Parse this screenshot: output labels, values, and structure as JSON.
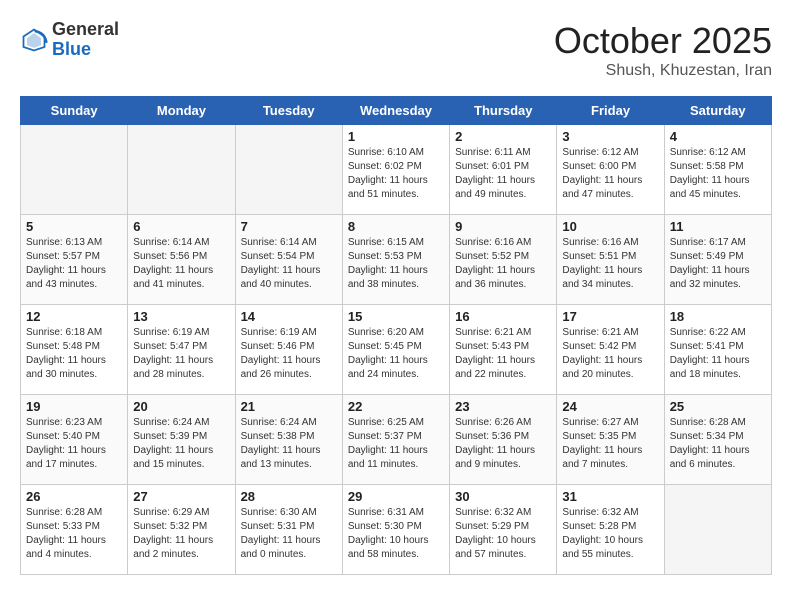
{
  "header": {
    "logo_general": "General",
    "logo_blue": "Blue",
    "month_title": "October 2025",
    "location": "Shush, Khuzestan, Iran"
  },
  "days_of_week": [
    "Sunday",
    "Monday",
    "Tuesday",
    "Wednesday",
    "Thursday",
    "Friday",
    "Saturday"
  ],
  "weeks": [
    [
      {
        "day": "",
        "info": ""
      },
      {
        "day": "",
        "info": ""
      },
      {
        "day": "",
        "info": ""
      },
      {
        "day": "1",
        "info": "Sunrise: 6:10 AM\nSunset: 6:02 PM\nDaylight: 11 hours\nand 51 minutes."
      },
      {
        "day": "2",
        "info": "Sunrise: 6:11 AM\nSunset: 6:01 PM\nDaylight: 11 hours\nand 49 minutes."
      },
      {
        "day": "3",
        "info": "Sunrise: 6:12 AM\nSunset: 6:00 PM\nDaylight: 11 hours\nand 47 minutes."
      },
      {
        "day": "4",
        "info": "Sunrise: 6:12 AM\nSunset: 5:58 PM\nDaylight: 11 hours\nand 45 minutes."
      }
    ],
    [
      {
        "day": "5",
        "info": "Sunrise: 6:13 AM\nSunset: 5:57 PM\nDaylight: 11 hours\nand 43 minutes."
      },
      {
        "day": "6",
        "info": "Sunrise: 6:14 AM\nSunset: 5:56 PM\nDaylight: 11 hours\nand 41 minutes."
      },
      {
        "day": "7",
        "info": "Sunrise: 6:14 AM\nSunset: 5:54 PM\nDaylight: 11 hours\nand 40 minutes."
      },
      {
        "day": "8",
        "info": "Sunrise: 6:15 AM\nSunset: 5:53 PM\nDaylight: 11 hours\nand 38 minutes."
      },
      {
        "day": "9",
        "info": "Sunrise: 6:16 AM\nSunset: 5:52 PM\nDaylight: 11 hours\nand 36 minutes."
      },
      {
        "day": "10",
        "info": "Sunrise: 6:16 AM\nSunset: 5:51 PM\nDaylight: 11 hours\nand 34 minutes."
      },
      {
        "day": "11",
        "info": "Sunrise: 6:17 AM\nSunset: 5:49 PM\nDaylight: 11 hours\nand 32 minutes."
      }
    ],
    [
      {
        "day": "12",
        "info": "Sunrise: 6:18 AM\nSunset: 5:48 PM\nDaylight: 11 hours\nand 30 minutes."
      },
      {
        "day": "13",
        "info": "Sunrise: 6:19 AM\nSunset: 5:47 PM\nDaylight: 11 hours\nand 28 minutes."
      },
      {
        "day": "14",
        "info": "Sunrise: 6:19 AM\nSunset: 5:46 PM\nDaylight: 11 hours\nand 26 minutes."
      },
      {
        "day": "15",
        "info": "Sunrise: 6:20 AM\nSunset: 5:45 PM\nDaylight: 11 hours\nand 24 minutes."
      },
      {
        "day": "16",
        "info": "Sunrise: 6:21 AM\nSunset: 5:43 PM\nDaylight: 11 hours\nand 22 minutes."
      },
      {
        "day": "17",
        "info": "Sunrise: 6:21 AM\nSunset: 5:42 PM\nDaylight: 11 hours\nand 20 minutes."
      },
      {
        "day": "18",
        "info": "Sunrise: 6:22 AM\nSunset: 5:41 PM\nDaylight: 11 hours\nand 18 minutes."
      }
    ],
    [
      {
        "day": "19",
        "info": "Sunrise: 6:23 AM\nSunset: 5:40 PM\nDaylight: 11 hours\nand 17 minutes."
      },
      {
        "day": "20",
        "info": "Sunrise: 6:24 AM\nSunset: 5:39 PM\nDaylight: 11 hours\nand 15 minutes."
      },
      {
        "day": "21",
        "info": "Sunrise: 6:24 AM\nSunset: 5:38 PM\nDaylight: 11 hours\nand 13 minutes."
      },
      {
        "day": "22",
        "info": "Sunrise: 6:25 AM\nSunset: 5:37 PM\nDaylight: 11 hours\nand 11 minutes."
      },
      {
        "day": "23",
        "info": "Sunrise: 6:26 AM\nSunset: 5:36 PM\nDaylight: 11 hours\nand 9 minutes."
      },
      {
        "day": "24",
        "info": "Sunrise: 6:27 AM\nSunset: 5:35 PM\nDaylight: 11 hours\nand 7 minutes."
      },
      {
        "day": "25",
        "info": "Sunrise: 6:28 AM\nSunset: 5:34 PM\nDaylight: 11 hours\nand 6 minutes."
      }
    ],
    [
      {
        "day": "26",
        "info": "Sunrise: 6:28 AM\nSunset: 5:33 PM\nDaylight: 11 hours\nand 4 minutes."
      },
      {
        "day": "27",
        "info": "Sunrise: 6:29 AM\nSunset: 5:32 PM\nDaylight: 11 hours\nand 2 minutes."
      },
      {
        "day": "28",
        "info": "Sunrise: 6:30 AM\nSunset: 5:31 PM\nDaylight: 11 hours\nand 0 minutes."
      },
      {
        "day": "29",
        "info": "Sunrise: 6:31 AM\nSunset: 5:30 PM\nDaylight: 10 hours\nand 58 minutes."
      },
      {
        "day": "30",
        "info": "Sunrise: 6:32 AM\nSunset: 5:29 PM\nDaylight: 10 hours\nand 57 minutes."
      },
      {
        "day": "31",
        "info": "Sunrise: 6:32 AM\nSunset: 5:28 PM\nDaylight: 10 hours\nand 55 minutes."
      },
      {
        "day": "",
        "info": ""
      }
    ]
  ]
}
